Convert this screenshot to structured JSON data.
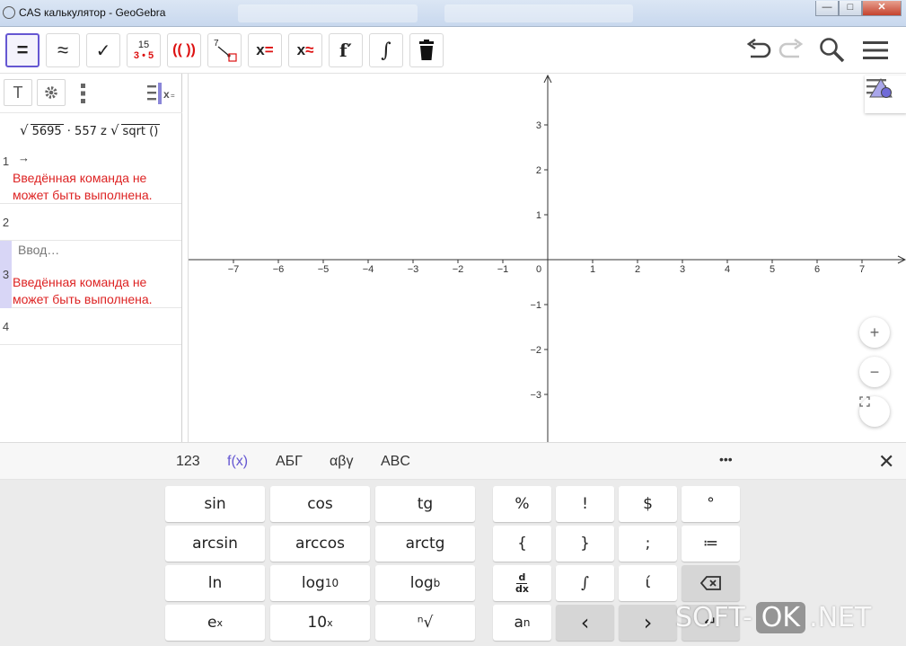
{
  "window": {
    "title": "CAS калькулятор - GeoGebra",
    "controls": [
      "—",
      "□",
      "✕"
    ]
  },
  "toolbar": {
    "tools": [
      {
        "name": "evaluate",
        "label": "="
      },
      {
        "name": "numeric",
        "label": "≈"
      },
      {
        "name": "keep-input",
        "label": "✓"
      },
      {
        "name": "factor",
        "label_top": "15",
        "label_bottom": "3 • 5"
      },
      {
        "name": "expand",
        "label": "(( ))"
      },
      {
        "name": "substitute",
        "label": "7"
      },
      {
        "name": "solve",
        "label": "x="
      },
      {
        "name": "solve-numerically",
        "label": "x≈"
      },
      {
        "name": "derivative",
        "label": "f′"
      },
      {
        "name": "integral",
        "label": "∫"
      },
      {
        "name": "delete",
        "label": ""
      }
    ]
  },
  "cas": {
    "header": {
      "text_tool": "T"
    },
    "rows": [
      {
        "num": "1",
        "expr_radicand": "5695",
        "expr_middle": "· 557 z",
        "expr_sqrt": "sqrt ()",
        "arrow": "→",
        "error_line1": "Введённая команда не",
        "error_line2": "может быть выполнена."
      },
      {
        "num": "2"
      },
      {
        "num": "3",
        "placeholder": "Ввод…",
        "error_line1": "Введённая команда не",
        "error_line2": "может быть выполнена."
      },
      {
        "num": "4"
      }
    ]
  },
  "graphics": {
    "x_ticks": [
      "−7",
      "−6",
      "−5",
      "−4",
      "−3",
      "−2",
      "−1",
      "0",
      "1",
      "2",
      "3",
      "4",
      "5",
      "6",
      "7"
    ],
    "y_ticks": [
      "3",
      "2",
      "1",
      "−1",
      "−2",
      "−3"
    ],
    "zoom_in": "+",
    "zoom_out": "−",
    "fullscreen": "⛶"
  },
  "keyboard": {
    "tabs": [
      "123",
      "f(x)",
      "АБГ",
      "αβγ",
      "ABC",
      "•••"
    ],
    "selected_tab": "f(x)",
    "close": "✕",
    "keys": {
      "sin": "sin",
      "cos": "cos",
      "tg": "tg",
      "arcsin": "arcsin",
      "arccos": "arccos",
      "arctg": "arctg",
      "ln": "ln",
      "log10_base": "log",
      "log10_sub": "10",
      "logb_base": "log",
      "logb_sub": "b",
      "ex_base": "e",
      "ex_sup": "x",
      "tenx_base": "10",
      "tenx_sup": "x",
      "nroot": "ⁿ√",
      "percent": "%",
      "factorial": "!",
      "dollar": "$",
      "degree": "°",
      "lbrace": "{",
      "rbrace": "}",
      "semicolon": ";",
      "define": "≔",
      "ddx_top": "d",
      "ddx_bottom": "dx",
      "integral": "∫",
      "imag": "ί",
      "an_base": "a",
      "an_sub": "n",
      "left": "‹",
      "right": "›",
      "enter": "↵"
    }
  },
  "watermark": {
    "left": "SOFT-",
    "ok": "OK",
    "right": ".NET"
  }
}
